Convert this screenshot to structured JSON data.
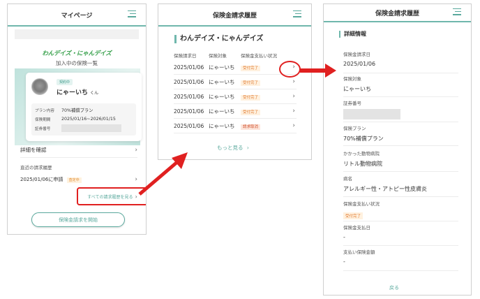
{
  "colors": {
    "accent": "#5aa99d",
    "annotation_red": "#e02020",
    "status_orange": "#e0782c"
  },
  "screen1": {
    "title": "マイページ",
    "logo": "わんデイズ・にゃんデイズ",
    "subtitle": "加入中の保険一覧",
    "card": {
      "badge": "契約中",
      "pet_name": "にゃーいち",
      "pet_suffix": "くん",
      "rows": [
        {
          "label": "プラン内容",
          "value": "70%補償プラン"
        },
        {
          "label": "保険期間",
          "value": "2025/01/16~2026/01/15"
        },
        {
          "label": "証券番号",
          "value": ""
        }
      ]
    },
    "detail_link": "詳細を確認",
    "recent_label": "直近の請求履歴",
    "recent_item": "2025/01/06に申請",
    "recent_badge": "査定中",
    "all_history_link": "すべての請求履歴を見る",
    "start_button": "保険金請求を開始"
  },
  "screen2": {
    "title": "保険金請求履歴",
    "section_title": "わんデイズ・にゃんデイズ",
    "headers": [
      "保険請求日",
      "保険対象",
      "保険金支払い状況"
    ],
    "rows": [
      {
        "date": "2025/01/06",
        "target": "にゃーいち",
        "status": "受付完了"
      },
      {
        "date": "2025/01/06",
        "target": "にゃーいち",
        "status": "受付完了"
      },
      {
        "date": "2025/01/06",
        "target": "にゃーいち",
        "status": "受付完了"
      },
      {
        "date": "2025/01/06",
        "target": "にゃーいち",
        "status": "受付完了"
      },
      {
        "date": "2025/01/06",
        "target": "にゃーいち",
        "status": "請求取消"
      }
    ],
    "more_link": "もっと見る"
  },
  "screen3": {
    "title": "保険金請求履歴",
    "section_title": "詳細情報",
    "fields": [
      {
        "label": "保険金請求日",
        "value": "2025/01/06"
      },
      {
        "label": "保険対象",
        "value": "にゃーいち"
      },
      {
        "label": "証券番号",
        "value": ""
      },
      {
        "label": "保険プラン",
        "value": "70%補償プラン"
      },
      {
        "label": "かかった動物病院",
        "value": "リトル動物病院"
      },
      {
        "label": "病名",
        "value": "アレルギー性・アトピー性皮膚炎"
      },
      {
        "label": "保険金支払い状況",
        "value": "受付完了"
      },
      {
        "label": "保険金支払日",
        "value": "-"
      },
      {
        "label": "支払い保険金額",
        "value": "-"
      }
    ],
    "back_link": "戻る"
  }
}
